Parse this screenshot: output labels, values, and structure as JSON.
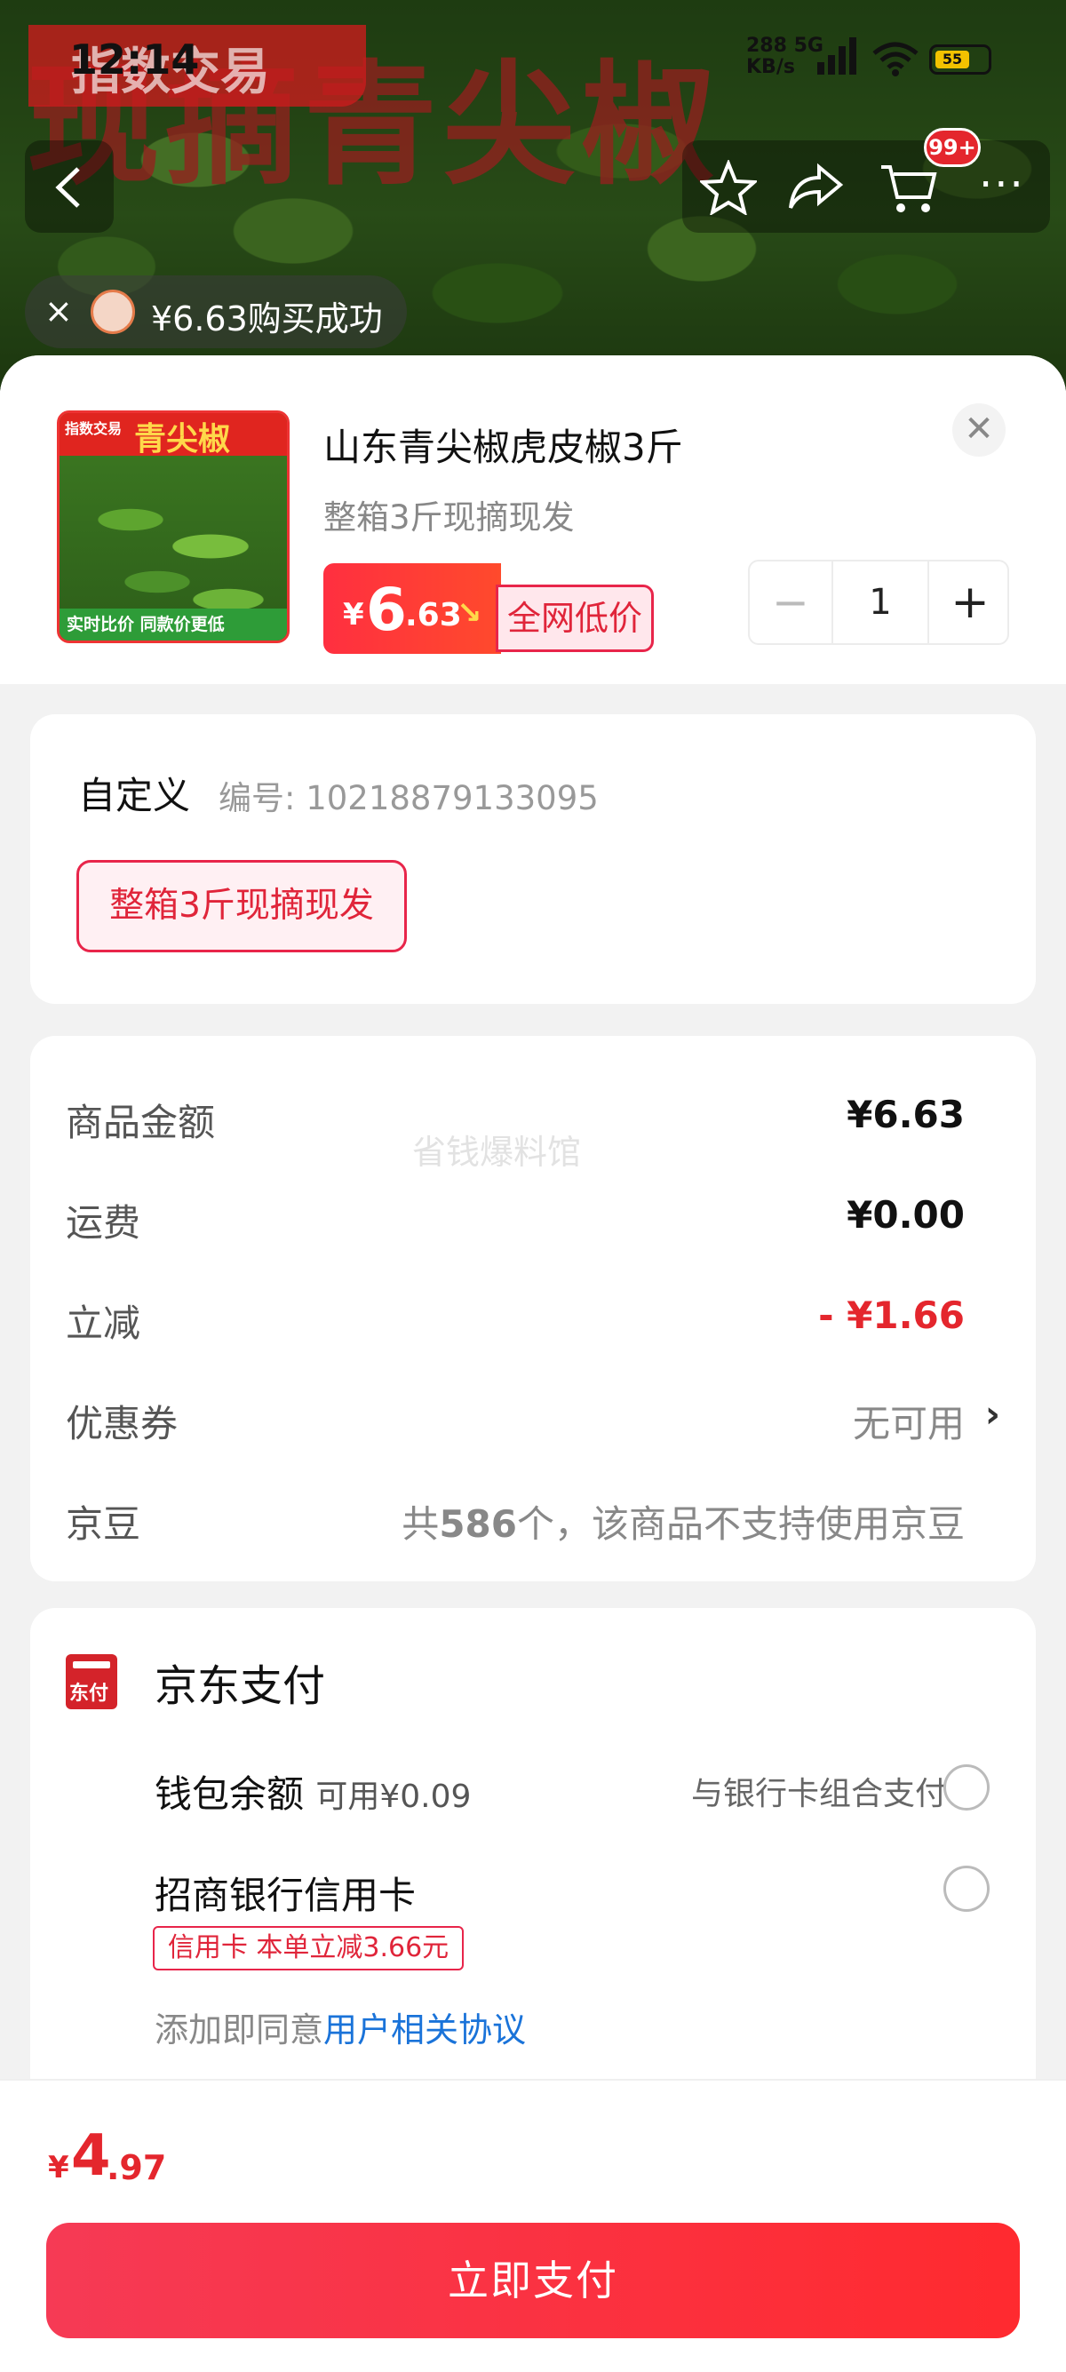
{
  "status_bar": {
    "time": "12:14",
    "net_speed": "288",
    "net_unit": "KB/s",
    "net_type": "5G",
    "battery": "55"
  },
  "background": {
    "banner_title": "现摘青尖椒",
    "brand": "指数交易"
  },
  "nav": {
    "back_icon": "chevron-left-icon",
    "favorite_icon": "star-icon",
    "share_icon": "share-icon",
    "cart_icon": "cart-icon",
    "cart_badge": "99+",
    "more_icon": "more-icon"
  },
  "toast": {
    "text": "¥6.63购买成功"
  },
  "product": {
    "title": "山东青尖椒虎皮椒3斤",
    "subtitle": "整箱3斤现摘现发",
    "price_symbol": "¥",
    "price_int": "6",
    "price_dec": ".63",
    "tag": "全网低价",
    "quantity": "1",
    "thumb_brand": "指数交易",
    "thumb_name": "青尖椒",
    "thumb_slogan": "实时比价 同款价更低"
  },
  "spec": {
    "label": "自定义",
    "code": "编号: 10218879133095",
    "option": "整箱3斤现摘现发"
  },
  "fees": {
    "watermark": "省钱爆料馆",
    "rows": [
      {
        "label": "商品金额",
        "value": "¥6.63"
      },
      {
        "label": "运费",
        "value": "¥0.00"
      },
      {
        "label": "立减",
        "value": "- ¥1.66"
      },
      {
        "label": "优惠券",
        "value": "无可用"
      }
    ],
    "jd_bean_label": "京豆",
    "jd_bean_pre": "共",
    "jd_bean_count": "586",
    "jd_bean_post": "个，该商品不支持使用京豆"
  },
  "payment": {
    "icon_text": "东付",
    "title": "京东支付",
    "wallet_label": "钱包余额",
    "wallet_available": "可用¥0.09",
    "wallet_combo": "与银行卡组合支付",
    "card_label": "招商银行信用卡",
    "card_promo": "信用卡 本单立减3.66元",
    "agree_prefix": "添加即同意",
    "agree_link": "用户相关协议"
  },
  "footer": {
    "total_symbol": "¥",
    "total_int": "4",
    "total_dec": ".97",
    "pay_button": "立即支付"
  },
  "colors": {
    "accent": "#e4262d",
    "link": "#1a73d9"
  }
}
